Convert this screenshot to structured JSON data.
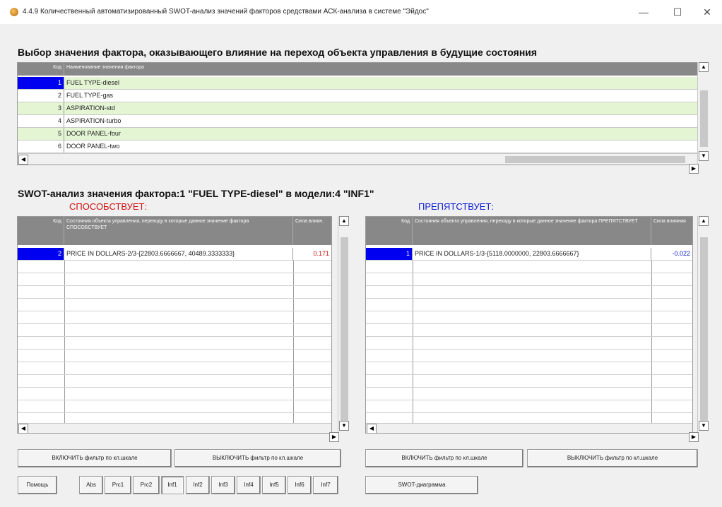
{
  "window": {
    "title": "4.4.9 Количественный автоматизированный SWOT-анализ значений факторов средствами АСК-анализа в системе \"Эйдос\"",
    "minimize": "—",
    "maximize": "☐",
    "close": "✕"
  },
  "factor_section": {
    "heading": "Выбор значения фактора, оказывающего влияние на переход объекта управления в будущие состояния",
    "col_code": "Код",
    "col_name": "Наименование значения фактора",
    "rows": [
      {
        "code": "1",
        "name": "FUEL TYPE-diesel"
      },
      {
        "code": "2",
        "name": "FUEL TYPE-gas"
      },
      {
        "code": "3",
        "name": "ASPIRATION-std"
      },
      {
        "code": "4",
        "name": "ASPIRATION-turbo"
      },
      {
        "code": "5",
        "name": "DOOR PANEL-four"
      },
      {
        "code": "6",
        "name": "DOOR PANEL-two"
      }
    ]
  },
  "swot": {
    "heading": "SWOT-анализ значения фактора:1 \"FUEL TYPE-diesel\" в модели:4 \"INF1\"",
    "promotes_label": "СПОСОБСТВУЕТ:",
    "hinders_label": "ПРЕПЯТСТВУЕТ:",
    "left": {
      "col_code": "Код",
      "col_desc": "Состояния объекта управления, переходу в которые данное значение фактора СПОСОБСТВУЕТ",
      "col_strength": "Сила влиян.",
      "rows": [
        {
          "code": "2",
          "desc": "PRICE IN DOLLARS-2/3-{22803.6666667, 40489.3333333}",
          "strength": "0.171"
        }
      ]
    },
    "right": {
      "col_code": "Код",
      "col_desc": "Состояния объекта управления, переходу в которые данное значение фактора ПРЕПЯТСТВУЕТ",
      "col_strength": "Сила влияния",
      "rows": [
        {
          "code": "1",
          "desc": "PRICE IN DOLLARS-1/3-{5118.0000000, 22803.6666667}",
          "strength": "-0.022"
        }
      ]
    }
  },
  "buttons": {
    "left_filter_on": "ВКЛЮЧИТЬ фильтр по кл.шкале",
    "left_filter_off": "ВЫКЛЮЧИТЬ фильтр по кл.шкале",
    "right_filter_on": "ВКЛЮЧИТЬ фильтр по кл.шкале",
    "right_filter_off": "ВЫКЛЮЧИТЬ фильтр по кл.шкале",
    "help": "Помощь",
    "models": [
      "Abs",
      "Prc1",
      "Prc2",
      "Inf1",
      "Inf2",
      "Inf3",
      "Inf4",
      "Inf5",
      "Inf6",
      "Inf7"
    ],
    "selected_model": "Inf1",
    "swot_diagram": "SWOT-диаграмма"
  }
}
